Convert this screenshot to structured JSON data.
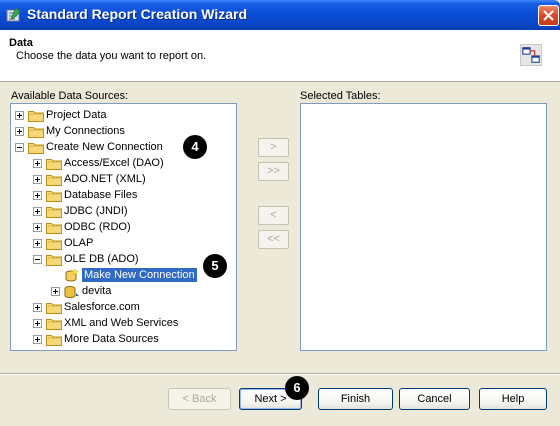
{
  "window": {
    "title": "Standard Report Creation Wizard"
  },
  "header": {
    "title": "Data",
    "subtitle": "Choose the data you want to report on."
  },
  "labels": {
    "available": "Available Data Sources:",
    "selected": "Selected Tables:"
  },
  "tree": {
    "items": [
      {
        "label": "Project Data",
        "level": 0,
        "expander": "plus",
        "icon": "folder-icon"
      },
      {
        "label": "My Connections",
        "level": 0,
        "expander": "plus",
        "icon": "folder-icon"
      },
      {
        "label": "Create New Connection",
        "level": 0,
        "expander": "minus",
        "icon": "folder-icon"
      },
      {
        "label": "Access/Excel (DAO)",
        "level": 1,
        "expander": "plus",
        "icon": "folder-icon"
      },
      {
        "label": "ADO.NET (XML)",
        "level": 1,
        "expander": "plus",
        "icon": "folder-icon"
      },
      {
        "label": "Database Files",
        "level": 1,
        "expander": "plus",
        "icon": "folder-icon"
      },
      {
        "label": "JDBC (JNDI)",
        "level": 1,
        "expander": "plus",
        "icon": "folder-icon"
      },
      {
        "label": "ODBC (RDO)",
        "level": 1,
        "expander": "plus",
        "icon": "folder-icon"
      },
      {
        "label": "OLAP",
        "level": 1,
        "expander": "plus",
        "icon": "folder-icon"
      },
      {
        "label": "OLE DB (ADO)",
        "level": 1,
        "expander": "minus",
        "icon": "folder-icon"
      },
      {
        "label": "Make New Connection",
        "level": 2,
        "expander": "none",
        "icon": "new-connection-icon",
        "selected": true
      },
      {
        "label": "devita",
        "level": 2,
        "expander": "plus",
        "icon": "database-icon"
      },
      {
        "label": "Salesforce.com",
        "level": 1,
        "expander": "plus",
        "icon": "folder-icon"
      },
      {
        "label": "XML and Web Services",
        "level": 1,
        "expander": "plus",
        "icon": "folder-icon"
      },
      {
        "label": "More Data Sources",
        "level": 1,
        "expander": "plus",
        "icon": "folder-icon"
      }
    ]
  },
  "move_buttons": {
    "add": ">",
    "add_all": ">>",
    "remove": "<",
    "remove_all": "<<"
  },
  "buttons": {
    "back": "< Back",
    "next": "Next >",
    "finish": "Finish",
    "cancel": "Cancel",
    "help": "Help"
  },
  "callouts": {
    "c4": "4",
    "c5": "5",
    "c6": "6"
  },
  "colors": {
    "selection": "#316ac5",
    "titlebar": "#0a4fd9",
    "folder": "#f5d77a"
  }
}
